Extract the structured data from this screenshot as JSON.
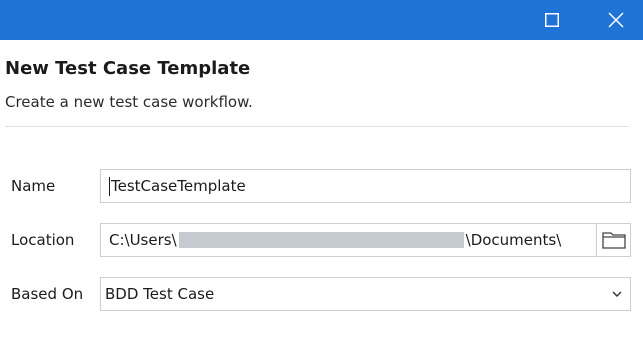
{
  "window": {
    "maximize_icon": "maximize-icon",
    "close_icon": "close-icon",
    "titlebar_color": "#1f73d6"
  },
  "header": {
    "title": "New Test Case Template",
    "subtitle": "Create a new test case workflow."
  },
  "form": {
    "name": {
      "label": "Name",
      "value": "TestCaseTemplate"
    },
    "location": {
      "label": "Location",
      "value_prefix": "C:\\Users\\",
      "value_suffix": "\\Documents\\",
      "browse_icon": "folder-icon"
    },
    "based_on": {
      "label": "Based On",
      "selected": "BDD Test Case",
      "dropdown_icon": "chevron-down-icon"
    }
  }
}
